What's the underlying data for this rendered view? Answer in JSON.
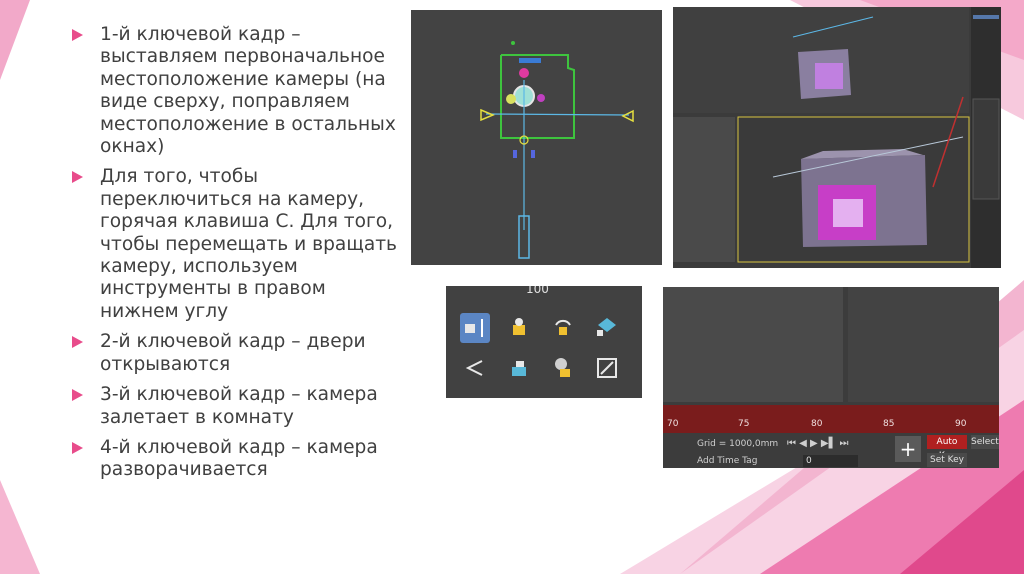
{
  "bullets": [
    "1-й ключевой кадр – выставляем первоначальное местоположение камеры (на виде сверху, поправляем местоположение в остальных окнах)",
    "Для того, чтобы переключиться на камеру, горячая клавиша С. Для того, чтобы перемещать и вращать камеру, используем инструменты в правом нижнем углу",
    "2-й ключевой кадр – двери открываются",
    "3-й ключевой кадр – камера залетает в комнату",
    "4-й ключевой кадр – камера разворачивается"
  ],
  "nav_panel": {
    "readout": "100",
    "tools": [
      "dolly-camera-icon",
      "truck-camera-icon",
      "orbit-camera-icon",
      "roll-camera-icon",
      "field-of-view-icon",
      "pan-camera-icon",
      "orbit-camera-2-icon",
      "maximize-viewport-icon"
    ]
  },
  "timeline": {
    "ticks": [
      "70",
      "75",
      "80",
      "85",
      "90"
    ],
    "grid": "Grid = 1000,0mm",
    "add_time_tag": "Add Time Tag",
    "frame": "0",
    "auto_key": "Auto Key",
    "set_key": "Set Key",
    "selected": "Selecte"
  },
  "colors": {
    "accent": "#e84c8b",
    "pink_light": "#f5a7c9",
    "dark_ui": "#3c3c3c",
    "timeline_red": "#7a1c1c"
  }
}
